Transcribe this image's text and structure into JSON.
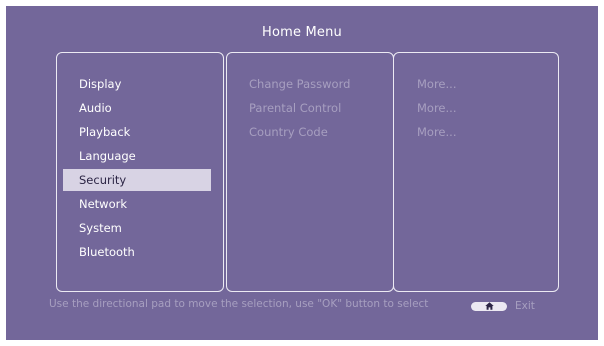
{
  "header": {
    "title": "Home Menu"
  },
  "menu": {
    "items": [
      {
        "label": "Display"
      },
      {
        "label": "Audio"
      },
      {
        "label": "Playback"
      },
      {
        "label": "Language"
      },
      {
        "label": "Security",
        "selected": true
      },
      {
        "label": "Network"
      },
      {
        "label": "System"
      },
      {
        "label": "Bluetooth"
      }
    ]
  },
  "submenu": {
    "items": [
      {
        "label": "Change Password",
        "more": "More..."
      },
      {
        "label": "Parental Control",
        "more": "More..."
      },
      {
        "label": "Country Code",
        "more": "More..."
      }
    ]
  },
  "footer": {
    "hint": "Use the directional pad to move the selection, use \"OK\" button to select",
    "exit_label": "Exit",
    "exit_icon": "home-icon"
  },
  "colors": {
    "background": "#73679a",
    "selection": "#d8d3e4",
    "dim_text": "#a79fc0"
  }
}
